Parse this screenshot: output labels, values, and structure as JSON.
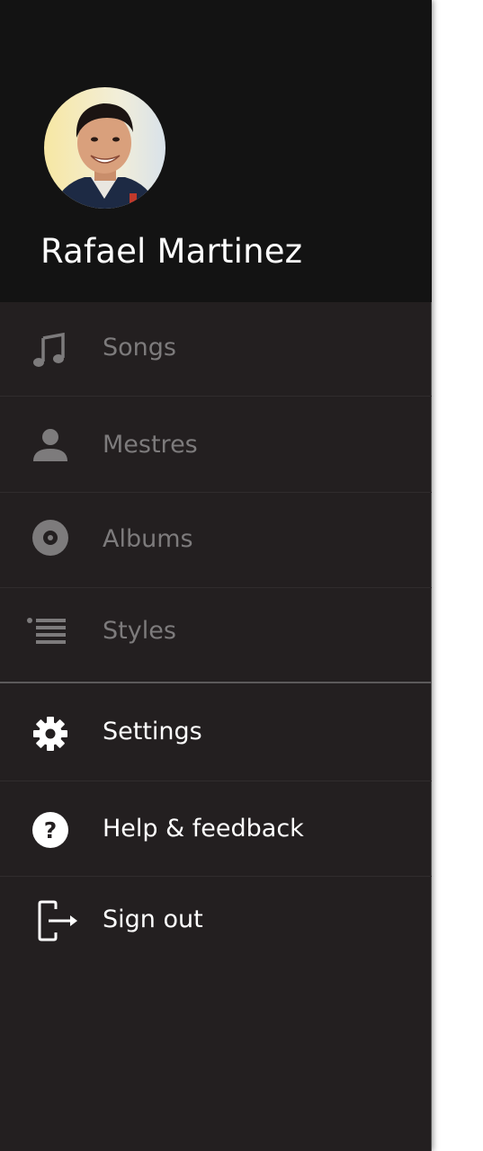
{
  "profile": {
    "name": "Rafael Martinez",
    "avatar_icon": "user-avatar-photo"
  },
  "menu": {
    "primary": [
      {
        "label": "Songs",
        "icon": "music-note-icon"
      },
      {
        "label": "Mestres",
        "icon": "person-icon"
      },
      {
        "label": "Albums",
        "icon": "disc-icon"
      },
      {
        "label": "Styles",
        "icon": "list-icon"
      }
    ],
    "secondary": [
      {
        "label": "Settings",
        "icon": "gear-icon"
      },
      {
        "label": "Help & feedback",
        "icon": "help-icon"
      },
      {
        "label": "Sign out",
        "icon": "sign-out-icon"
      }
    ]
  },
  "colors": {
    "drawer_bg": "#231f20",
    "header_bg": "#131313",
    "dim_text": "#7d7b7c",
    "bright_text": "#ffffff"
  }
}
